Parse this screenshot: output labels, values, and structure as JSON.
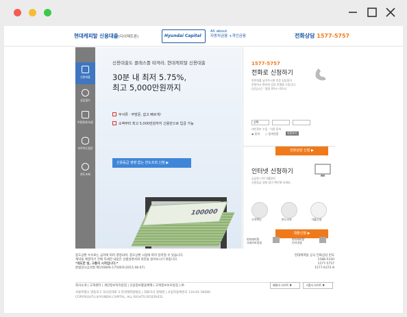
{
  "header": {
    "brand": "현대캐피탈 신용대출",
    "brand_sub": "(다이렉트론)",
    "logo": "Hyundai Capital",
    "about_line1": "All about",
    "about_line2": "자동차금융 +개인금융",
    "phone_label": "전화상담",
    "phone_number": "1577-5757"
  },
  "sidebar": {
    "items": [
      {
        "label": "신용대출",
        "icon": "loan-icon"
      },
      {
        "label": "상담접수",
        "icon": "consult-icon"
      },
      {
        "label": "이용절차/서류",
        "icon": "document-icon"
      },
      {
        "label": "자주하는질문",
        "icon": "faq-icon"
      },
      {
        "label": "한도조회",
        "icon": "limit-icon"
      }
    ]
  },
  "hero": {
    "subtitle": "신용대출도 클래스를 따져라, 현대캐피탈 신용대출",
    "title_line1": "30분 내 최저 5.75%,",
    "title_line2": "최고 5,000만원까지",
    "bullet1": "무서류 · 무방문, 쉽고 빠르게!",
    "bullet2": "소액부터 최고 5,000만원까지 신용만으로 입금 가능",
    "cta": "신용등급 영향 없는 한도조회 신청 ▶",
    "bill_text": "100000"
  },
  "phone_apply": {
    "phone": "1577-5757",
    "title": "전화로 신청하기",
    "desc_line1": "연락처를 남겨주시면 전문 상담원이",
    "desc_line2": "친절하고 편리한 상담 연결을 드립니다.",
    "desc_line3": "(상담시간 : 평일 09시~20시)",
    "select_value": "선택",
    "radio_label": "개인정보 수집 · 이용 동의",
    "radio_yes": "동의",
    "radio_no": "동의안함",
    "terms_btn": "약관보기",
    "button": "전화상담 신청 ▶"
  },
  "internet_apply": {
    "title": "인터넷 신청하기",
    "desc_line1": "궁금한 나의 대출한도",
    "desc_line2": "신용등급 영향 없이 확인해 보세요.",
    "steps": [
      "고객확인",
      "한도조회",
      "대출신청"
    ],
    "button": "대출신청 ▶"
  },
  "bottom_links": [
    {
      "line1": "현대캐피탈",
      "line2": "국제모바일앱"
    },
    {
      "line1": "현대캐피탈",
      "line2": "인터넷앱"
    }
  ],
  "footer": {
    "notice_line1": "중도상환 수수료는 금리에 따라 결정되며, 중도상환 시점에 따라 달라질 수 있습니다.",
    "notice_line2": "계약을 체결하기 전에 자세한 내용은 상품설명서와 약관을 읽어보시기 바랍니다.",
    "notice_line3": "*개도한 빚, 고통의 시작입니다.*",
    "notice_line4": "준법감시심의필 제150806-17500호(2015.08.07)",
    "right_title": "현대캐피탈 공식 전화상담 번호",
    "right_nums": [
      "1588-5330",
      "1577-5757",
      "1577-6372-8"
    ],
    "links_row": "회사소개  |  고객센터  |  개인정보처리방침  |  신용정보활용체제  |  고객정보보호방침  |  IR",
    "info_line1": "서울특별시 영등포구 의사당대로 3 현대캐피탈빌딩  |  대표이사 정태영  |  사업자등록번호 116-81-36086",
    "info_line2": "COPYRIGHT(c)HYUNDAI CAPITAL. ALL RIGHTS RESERVED.",
    "select1": "패밀리 사이트 ▼",
    "select2": "그룹사 사이트 ▼"
  }
}
